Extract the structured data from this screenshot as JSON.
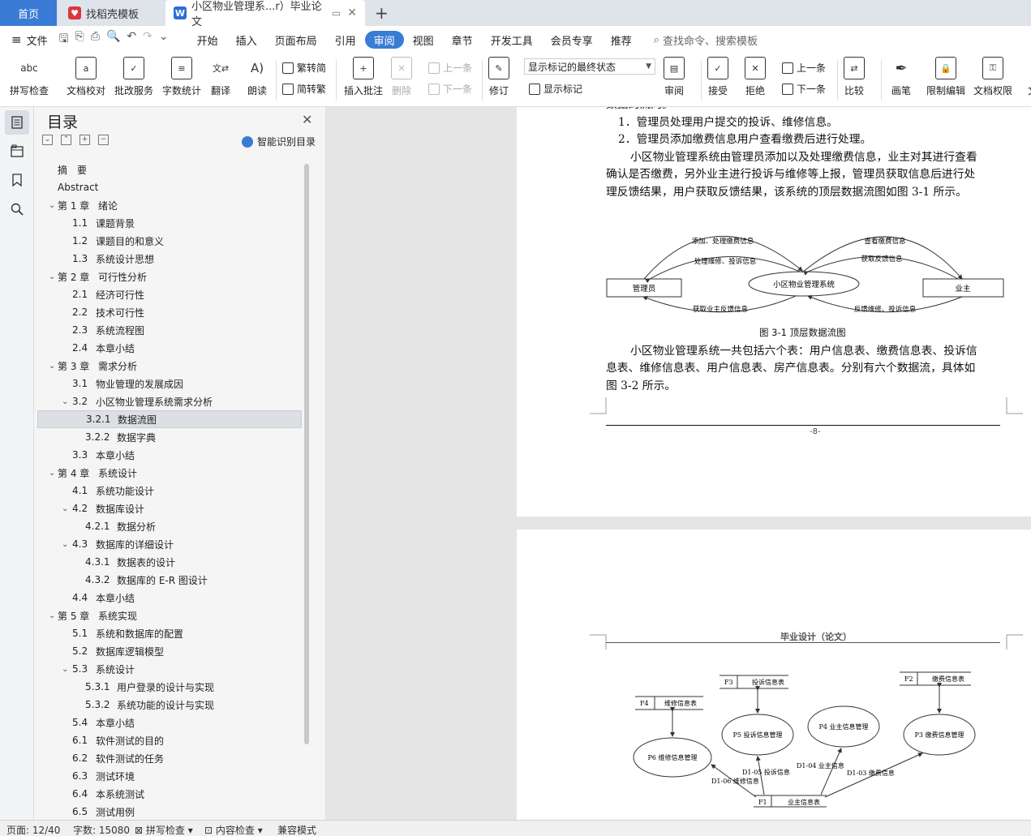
{
  "tabs": {
    "home": "首页",
    "template": "找稻壳模板",
    "doc_title": "小区物业管理系...r）毕业论文"
  },
  "menubar": {
    "file_label": "文件",
    "tabs": [
      "开始",
      "插入",
      "页面布局",
      "引用",
      "审阅",
      "视图",
      "章节",
      "开发工具",
      "会员专享",
      "推荐"
    ],
    "search_placeholder": "查找命令、搜索模板"
  },
  "ribbon": {
    "spell_check": "拼写检查",
    "doc_proof": "文档校对",
    "revise_service": "批改服务",
    "word_count": "字数统计",
    "translate": "翻译",
    "read_aloud": "朗读",
    "trad_to_simp": "繁转简",
    "simp_to_trad": "简转繁",
    "insert_comment": "插入批注",
    "delete": "删除",
    "prev_comment": "上一条",
    "next_comment": "下一条",
    "track_changes": "修订",
    "markup_state": "显示标记的最终状态",
    "show_markup": "显示标记",
    "review": "审阅",
    "accept": "接受",
    "reject": "拒绝",
    "prev_change": "上一条",
    "next_change": "下一条",
    "compare": "比较",
    "pen": "画笔",
    "restrict_edit": "限制编辑",
    "doc_permission": "文档权限",
    "more": "文"
  },
  "toc": {
    "title": "目录",
    "smart_label": "智能识别目录",
    "items": [
      {
        "num": "",
        "label": "摘　要",
        "level": 0,
        "chev": ""
      },
      {
        "num": "",
        "label": "Abstract",
        "level": 0,
        "chev": ""
      },
      {
        "num": "第 1 章",
        "label": "绪论",
        "level": 0,
        "chev": "v"
      },
      {
        "num": "1.1",
        "label": "课题背景",
        "level": 1,
        "chev": ""
      },
      {
        "num": "1.2",
        "label": "课题目的和意义",
        "level": 1,
        "chev": ""
      },
      {
        "num": "1.3",
        "label": "系统设计思想",
        "level": 1,
        "chev": ""
      },
      {
        "num": "第 2 章",
        "label": "可行性分析",
        "level": 0,
        "chev": "v"
      },
      {
        "num": "2.1",
        "label": "经济可行性",
        "level": 1,
        "chev": ""
      },
      {
        "num": "2.2",
        "label": "技术可行性",
        "level": 1,
        "chev": ""
      },
      {
        "num": "2.3",
        "label": "系统流程图",
        "level": 1,
        "chev": ""
      },
      {
        "num": "2.4",
        "label": "本章小结",
        "level": 1,
        "chev": ""
      },
      {
        "num": "第 3 章",
        "label": "需求分析",
        "level": 0,
        "chev": "v"
      },
      {
        "num": "3.1",
        "label": "物业管理的发展成因",
        "level": 1,
        "chev": ""
      },
      {
        "num": "3.2",
        "label": "小区物业管理系统需求分析",
        "level": 1,
        "chev": "v"
      },
      {
        "num": "3.2.1",
        "label": "数据流图",
        "level": 2,
        "chev": "",
        "selected": true
      },
      {
        "num": "3.2.2",
        "label": "数据字典",
        "level": 2,
        "chev": ""
      },
      {
        "num": "3.3",
        "label": "本章小结",
        "level": 1,
        "chev": ""
      },
      {
        "num": "第 4 章",
        "label": "系统设计",
        "level": 0,
        "chev": "v"
      },
      {
        "num": "4.1",
        "label": "系统功能设计",
        "level": 1,
        "chev": ""
      },
      {
        "num": "4.2",
        "label": "数据库设计",
        "level": 1,
        "chev": "v"
      },
      {
        "num": "4.2.1",
        "label": "数据分析",
        "level": 2,
        "chev": ""
      },
      {
        "num": "4.3",
        "label": "数据库的详细设计",
        "level": 1,
        "chev": "v"
      },
      {
        "num": "4.3.1",
        "label": "数据表的设计",
        "level": 2,
        "chev": ""
      },
      {
        "num": "4.3.2",
        "label": "数据库的 E-R 图设计",
        "level": 2,
        "chev": ""
      },
      {
        "num": "4.4",
        "label": "本章小结",
        "level": 1,
        "chev": ""
      },
      {
        "num": "第 5 章",
        "label": "系统实现",
        "level": 0,
        "chev": "v"
      },
      {
        "num": "5.1",
        "label": "系统和数据库的配置",
        "level": 1,
        "chev": ""
      },
      {
        "num": "5.2",
        "label": "数据库逻辑模型",
        "level": 1,
        "chev": ""
      },
      {
        "num": "5.3",
        "label": "系统设计",
        "level": 1,
        "chev": "v"
      },
      {
        "num": "5.3.1",
        "label": "用户登录的设计与实现",
        "level": 2,
        "chev": ""
      },
      {
        "num": "5.3.2",
        "label": "系统功能的设计与实现",
        "level": 2,
        "chev": ""
      },
      {
        "num": "5.4",
        "label": "本章小结",
        "level": 1,
        "chev": ""
      },
      {
        "num": "6.1",
        "label": "软件测试的目的",
        "level": 1,
        "chev": ""
      },
      {
        "num": "6.2",
        "label": "软件测试的任务",
        "level": 1,
        "chev": ""
      },
      {
        "num": "6.3",
        "label": "测试环境",
        "level": 1,
        "chev": ""
      },
      {
        "num": "6.4",
        "label": "本系统测试",
        "level": 1,
        "chev": ""
      },
      {
        "num": "6.5",
        "label": "测试用例",
        "level": 1,
        "chev": ""
      }
    ]
  },
  "doc": {
    "cut_line": "数据的流向。",
    "list1": "1．管理员处理用户提交的投诉、维修信息。",
    "list2": "2．管理员添加缴费信息用户查看缴费后进行处理。",
    "para1_l1": "小区物业管理系统由管理员添加以及处理缴费信息，业主对其进行查看",
    "para1_l2": "确认是否缴费，另外业主进行投诉与维修等上报，管理员获取信息后进行处",
    "para1_l3": "理反馈结果，用户获取反馈结果，该系统的顶层数据流图如图 3-1 所示。",
    "fig1": {
      "admin": "管理员",
      "system": "小区物业管理系统",
      "owner": "业主",
      "f_add": "添加、处理缴费信息",
      "f_handle": "处理维修、投诉信息",
      "f_get_owner": "获取业主反馈信息",
      "f_view": "查看缴费信息",
      "f_get_feedback": "获取反馈信息",
      "f_feedback": "反馈维修、投诉信息",
      "caption": "图 3-1 顶层数据流图"
    },
    "para2_l1": "小区物业管理系统一共包括六个表：用户信息表、缴费信息表、投诉信",
    "para2_l2": "息表、维修信息表、用户信息表、房产信息表。分别有六个数据流，具体如",
    "para2_l3": "图 3-2 所示。",
    "page_num": "-8-",
    "header2": "毕业设计（论文）",
    "fig2": {
      "f3": "F3",
      "f3_name": "投诉信息表",
      "f2": "F2",
      "f2_name": "缴费信息表",
      "f4": "F4",
      "f4_name": "维修信息表",
      "f1": "F1",
      "f1_name": "业主信息表",
      "p5": "P5 投诉信息管理",
      "p4": "P4 业主信息管理",
      "p3": "P3 缴费信息管理",
      "p6": "P6 维修信息管理",
      "d105": "D1-05 投诉信息",
      "d104": "D1-04 业主信息",
      "d103": "D1-03 缴费信息",
      "d106": "D1-06 维修信息"
    }
  },
  "status": {
    "page": "页面: 12/40",
    "words": "字数: 15080",
    "spell": "拼写检查",
    "content_check": "内容检查",
    "compat": "兼容模式"
  }
}
